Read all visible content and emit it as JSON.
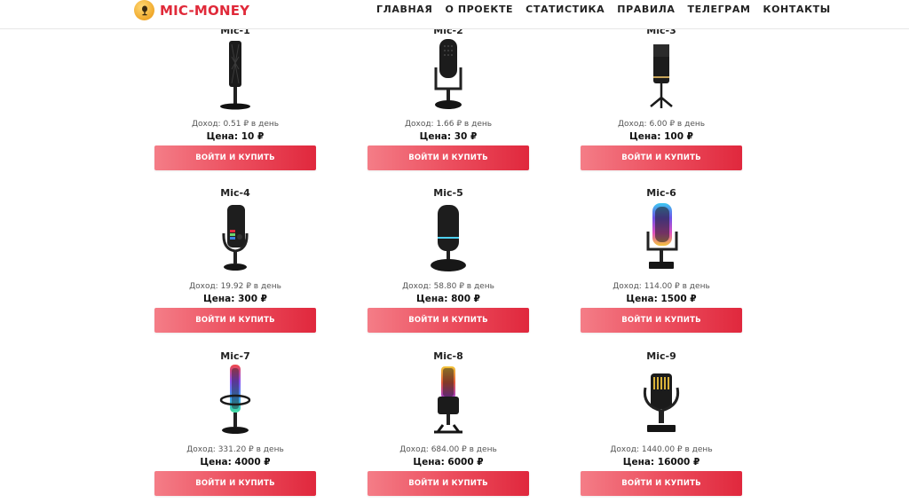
{
  "header": {
    "logo_text": "MIC-MONEY",
    "nav": [
      "ГЛАВНАЯ",
      "О ПРОЕКТЕ",
      "СТАТИСТИКА",
      "ПРАВИЛА",
      "ТЕЛЕГРАМ",
      "КОНТАКТЫ"
    ]
  },
  "colors": {
    "accent": "#e02a3a",
    "button_start": "#f47d87",
    "button_end": "#e0283d"
  },
  "products": [
    {
      "title": "Mic-1",
      "income": "Доход: 0.51 ₽ в день",
      "price": "Цена: 10 ₽",
      "button": "ВОЙТИ И КУПИТЬ",
      "icon": "microphone-slim-icon"
    },
    {
      "title": "Mic-2",
      "income": "Доход: 1.66 ₽ в день",
      "price": "Цена: 30 ₽",
      "button": "ВОЙТИ И КУПИТЬ",
      "icon": "microphone-stand-icon"
    },
    {
      "title": "Mic-3",
      "income": "Доход: 6.00 ₽ в день",
      "price": "Цена: 100 ₽",
      "button": "ВОЙТИ И КУПИТЬ",
      "icon": "microphone-tripod-icon"
    },
    {
      "title": "Mic-4",
      "income": "Доход: 19.92 ₽ в день",
      "price": "Цена: 300 ₽",
      "button": "ВОЙТИ И КУПИТЬ",
      "icon": "microphone-rgb-icon"
    },
    {
      "title": "Mic-5",
      "income": "Доход: 58.80 ₽ в день",
      "price": "Цена: 800 ₽",
      "button": "ВОЙТИ И КУПИТЬ",
      "icon": "microphone-round-base-icon"
    },
    {
      "title": "Mic-6",
      "income": "Доход: 114.00 ₽ в день",
      "price": "Цена: 1500 ₽",
      "button": "ВОЙТИ И КУПИТЬ",
      "icon": "microphone-rgb-stand-icon"
    },
    {
      "title": "Mic-7",
      "income": "Доход: 331.20 ₽ в день",
      "price": "Цена: 4000 ₽",
      "button": "ВОЙТИ И КУПИТЬ",
      "icon": "microphone-shockmount-icon"
    },
    {
      "title": "Mic-8",
      "income": "Доход: 684.00 ₽ в день",
      "price": "Цена: 6000 ₽",
      "button": "ВОЙТИ И КУПИТЬ",
      "icon": "microphone-studio-icon"
    },
    {
      "title": "Mic-9",
      "income": "Доход: 1440.00 ₽ в день",
      "price": "Цена: 16000 ₽",
      "button": "ВОЙТИ И КУПИТЬ",
      "icon": "microphone-gold-icon"
    }
  ]
}
